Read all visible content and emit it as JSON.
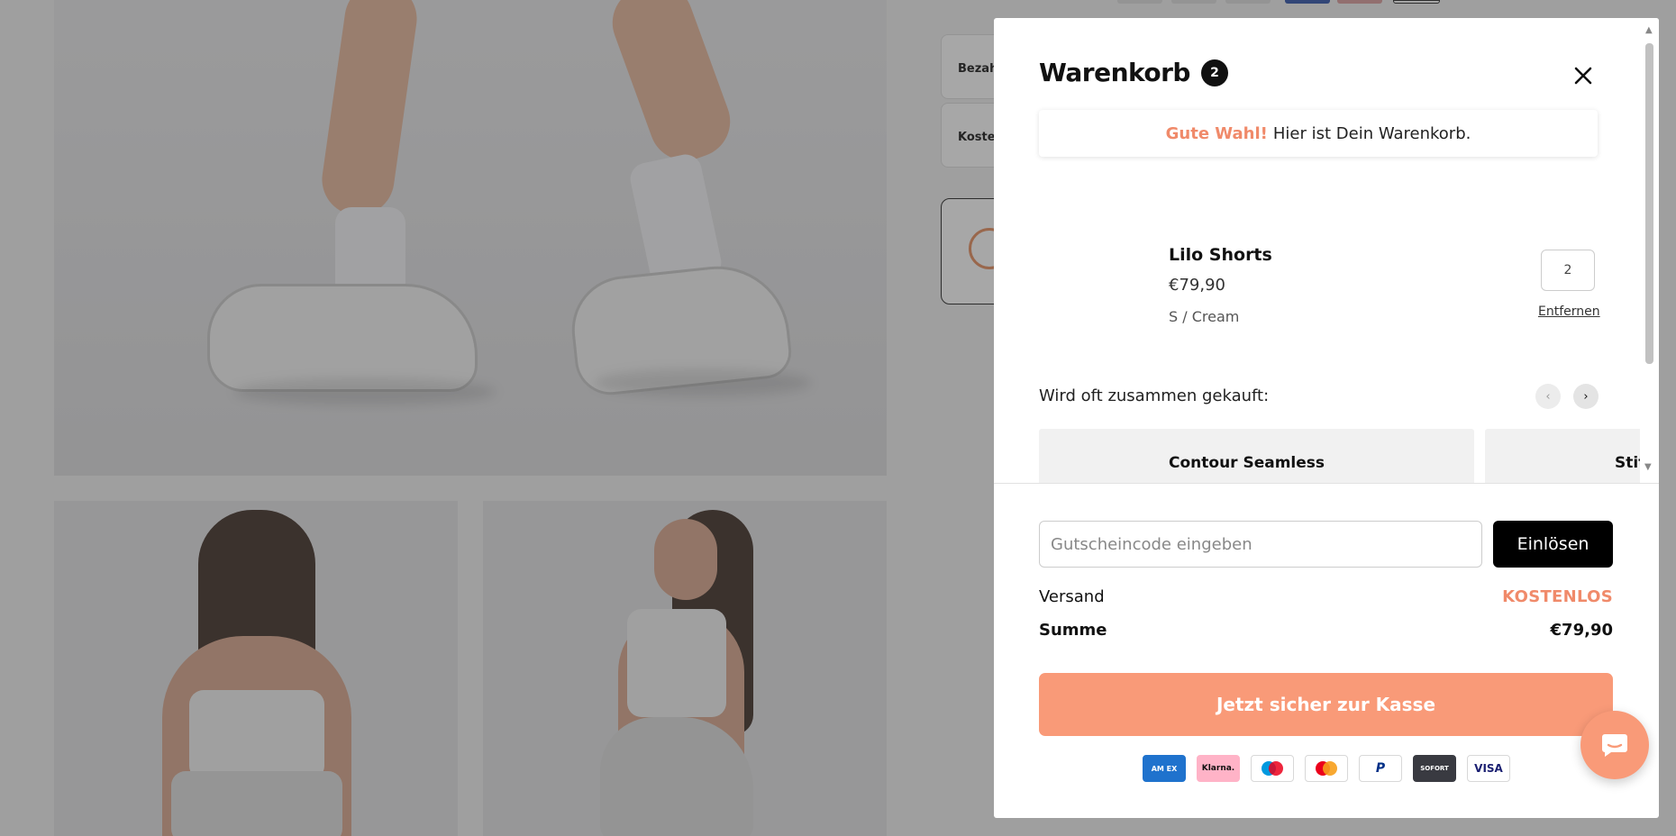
{
  "background": {
    "side_cards": [
      "Bezah",
      "Koste"
    ]
  },
  "cart": {
    "title": "Warenkorb",
    "count": "2",
    "banner": {
      "highlight": "Gute Wahl!",
      "text": "Hier ist Dein Warenkorb."
    },
    "items": [
      {
        "name": "Lilo Shorts",
        "price": "€79,90",
        "variant": "S / Cream",
        "quantity": "2",
        "remove_label": "Entfernen"
      }
    ],
    "upsell": {
      "title": "Wird oft zusammen gekauft:",
      "products": [
        "Contour Seamless",
        "Stit"
      ]
    },
    "coupon": {
      "placeholder": "Gutscheincode eingeben",
      "button": "Einlösen"
    },
    "shipping": {
      "label": "Versand",
      "value": "KOSTENLOS"
    },
    "total": {
      "label": "Summe",
      "value": "€79,90"
    },
    "checkout_label": "Jetzt sicher zur Kasse",
    "payment_methods": [
      {
        "icon": "amex-icon",
        "text": "AM EX",
        "color": "#1f72cd"
      },
      {
        "icon": "klarna-icon",
        "text": "Klarna.",
        "color": "#ffb3c7"
      },
      {
        "icon": "maestro-icon",
        "text": "",
        "color": "#0099df"
      },
      {
        "icon": "mastercard-icon",
        "text": "",
        "color": "#eb001b"
      },
      {
        "icon": "paypal-icon",
        "text": "P",
        "color": "#003087"
      },
      {
        "icon": "sofort-icon",
        "text": "SOFORT",
        "color": "#393a41"
      },
      {
        "icon": "visa-icon",
        "text": "VISA",
        "color": "#1a1f71"
      }
    ]
  },
  "colors": {
    "accent": "#f99a78",
    "accent_text": "#f08a6a"
  }
}
